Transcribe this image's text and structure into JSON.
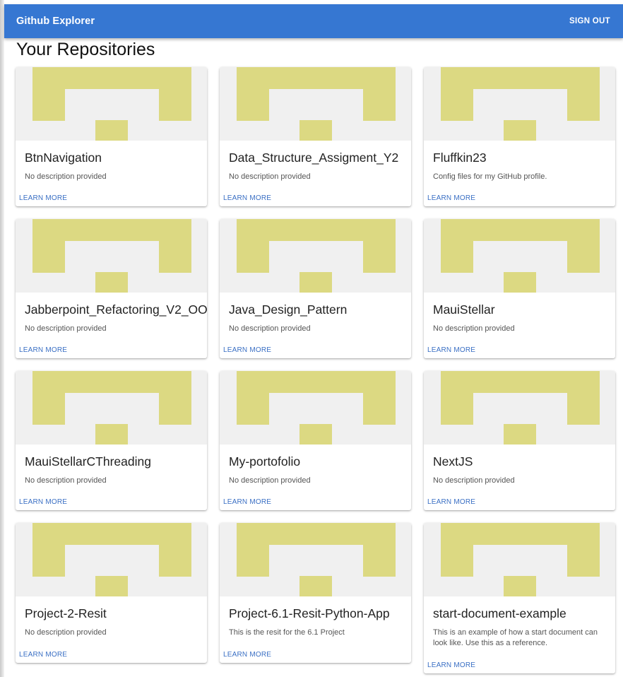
{
  "app": {
    "title": "Github Explorer",
    "sign_out_label": "SIGN OUT",
    "accent_color": "#3677d2"
  },
  "page": {
    "title": "Your Repositories"
  },
  "identicon": {
    "color": "#dcd982",
    "background": "#f0f0f0"
  },
  "repositories": [
    {
      "name": "BtnNavigation",
      "description": "No description provided",
      "action": "LEARN MORE"
    },
    {
      "name": "Data_Structure_Assigment_Y2",
      "description": "No description provided",
      "action": "LEARN MORE"
    },
    {
      "name": "Fluffkin23",
      "description": "Config files for my GitHub profile.",
      "action": "LEARN MORE"
    },
    {
      "name": "Jabberpoint_Refactoring_V2_OO",
      "description": "No description provided",
      "action": "LEARN MORE"
    },
    {
      "name": "Java_Design_Pattern",
      "description": "No description provided",
      "action": "LEARN MORE"
    },
    {
      "name": "MauiStellar",
      "description": "No description provided",
      "action": "LEARN MORE"
    },
    {
      "name": "MauiStellarCThreading",
      "description": "No description provided",
      "action": "LEARN MORE"
    },
    {
      "name": "My-portofolio",
      "description": "No description provided",
      "action": "LEARN MORE"
    },
    {
      "name": "NextJS",
      "description": "No description provided",
      "action": "LEARN MORE"
    },
    {
      "name": "Project-2-Resit",
      "description": "No description provided",
      "action": "LEARN MORE"
    },
    {
      "name": "Project-6.1-Resit-Python-App",
      "description": "This is the resit for the 6.1 Project",
      "action": "LEARN MORE"
    },
    {
      "name": "start-document-example",
      "description": "This is an example of how a start document can look like. Use this as a reference.",
      "action": "LEARN MORE"
    }
  ]
}
